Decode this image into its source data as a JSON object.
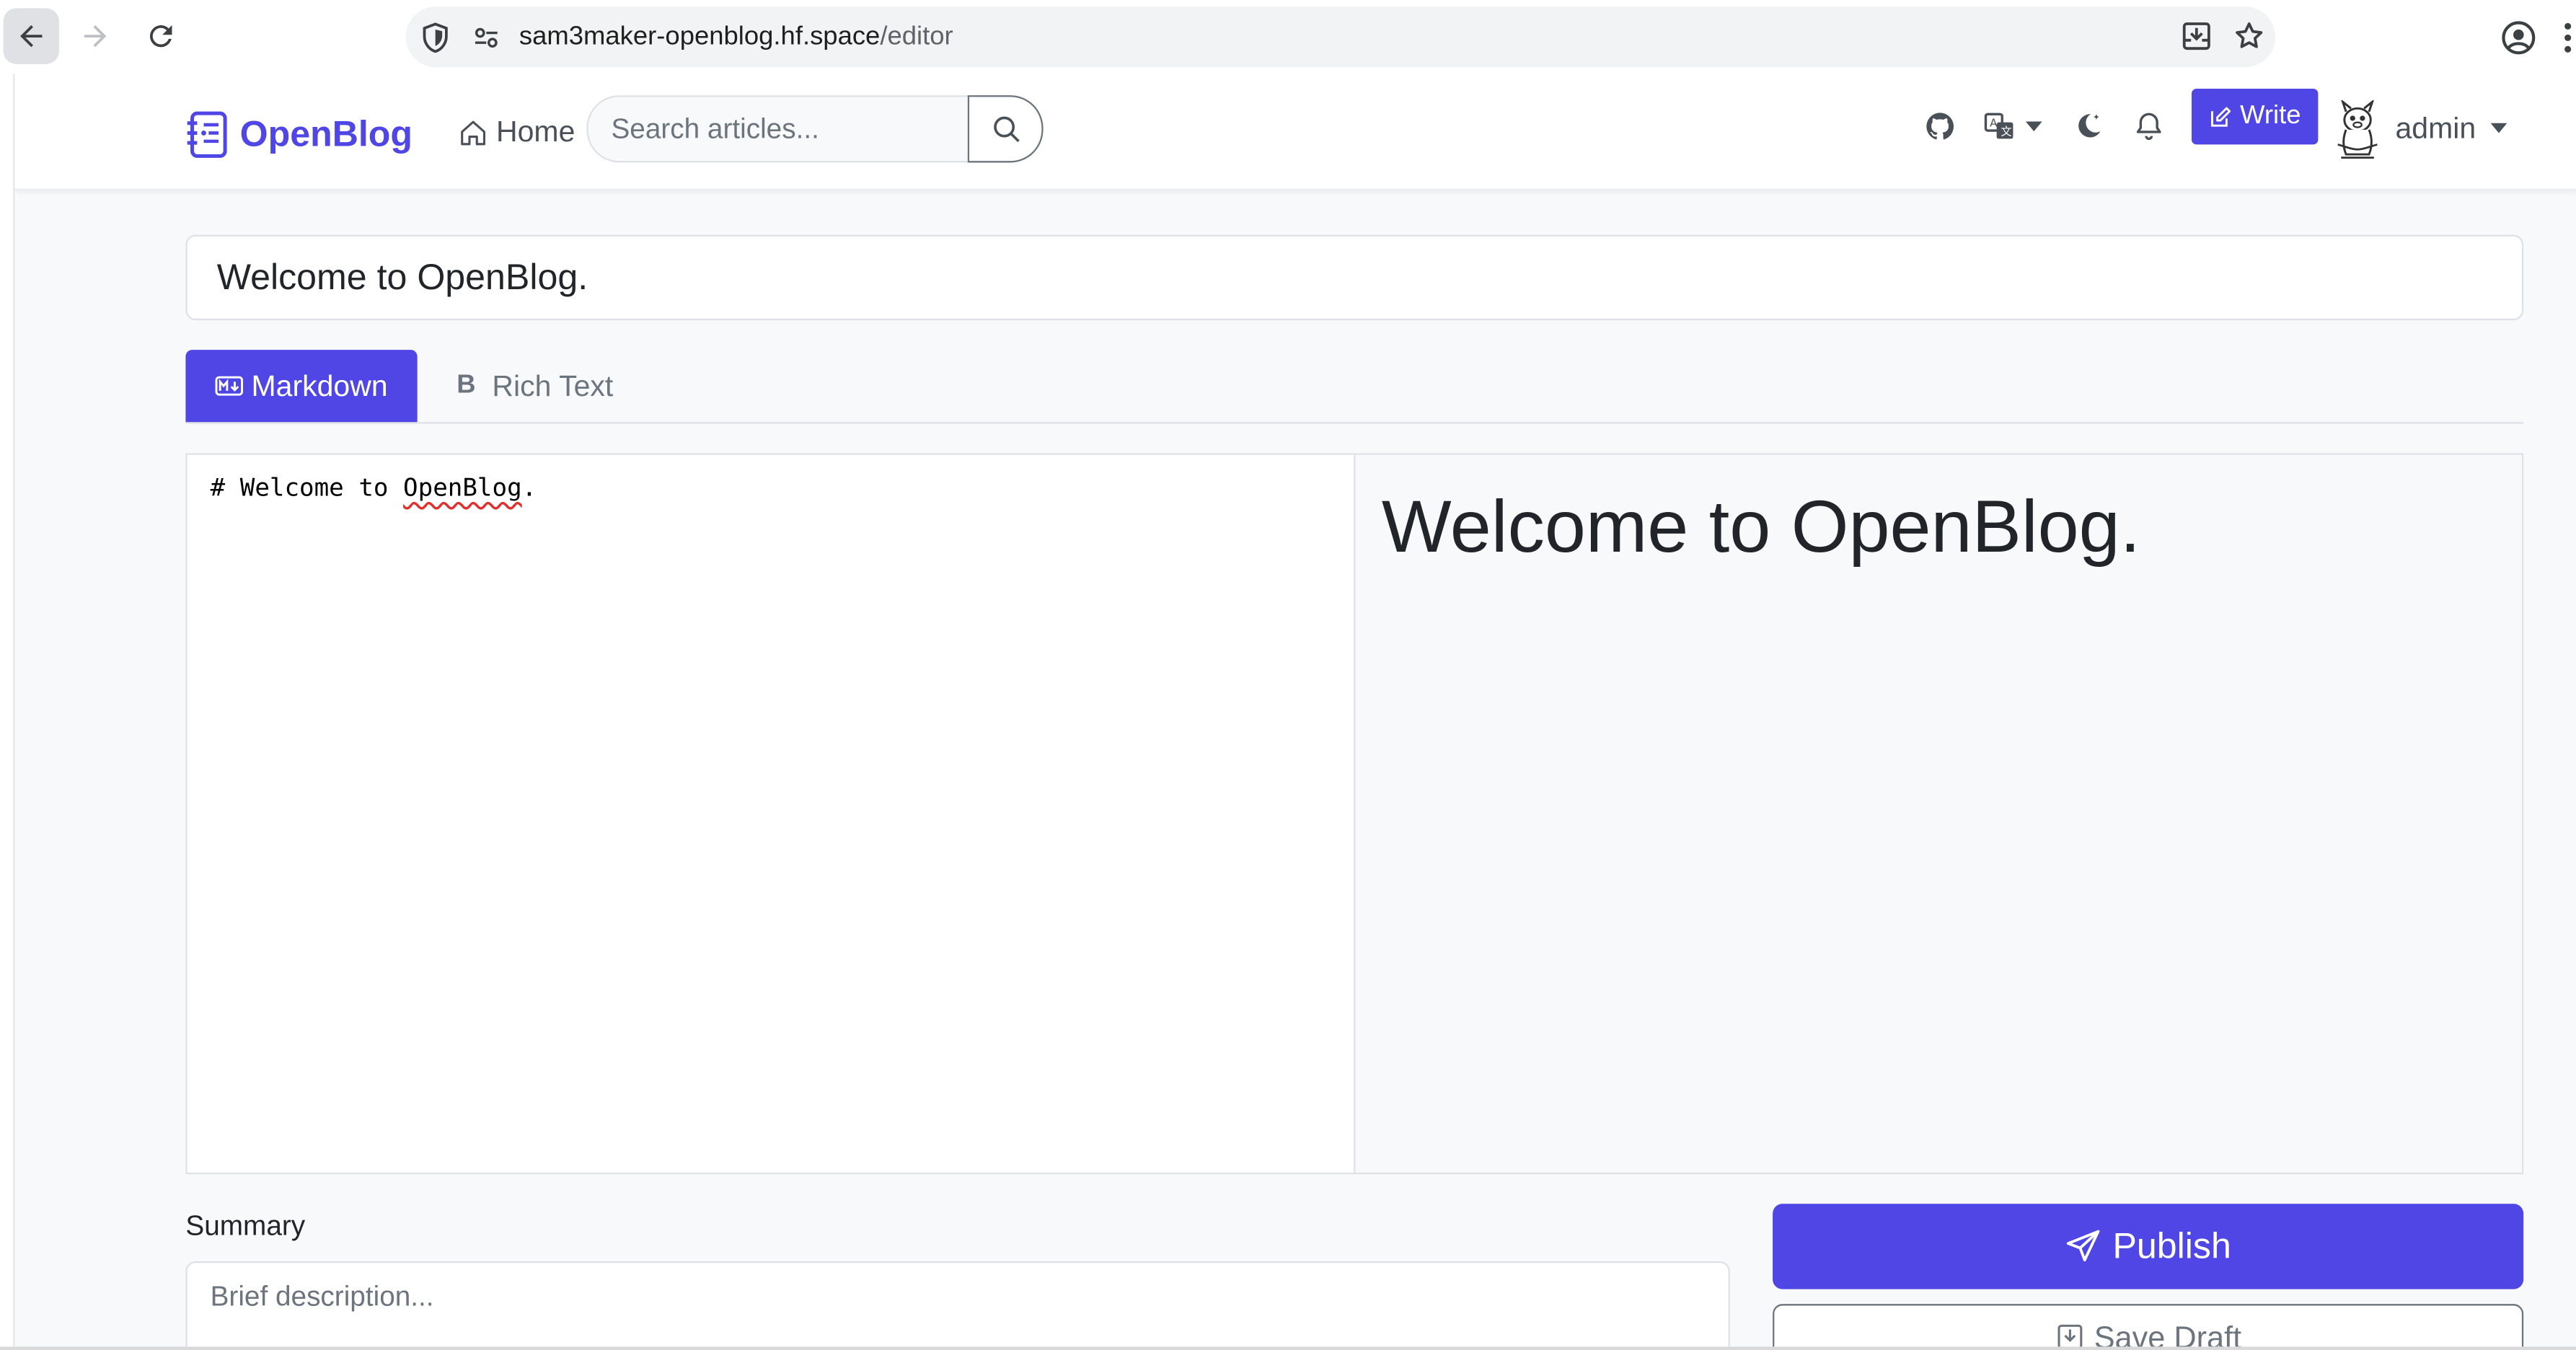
{
  "browser": {
    "url_host": "sam3maker-openblog.hf.space",
    "url_path": "/editor"
  },
  "header": {
    "brand": "OpenBlog",
    "home_label": "Home",
    "search_placeholder": "Search articles...",
    "write_label": "Write",
    "username": "admin"
  },
  "editor": {
    "title_value": "Welcome to OpenBlog.",
    "tabs": [
      {
        "label": "Markdown",
        "active": true
      },
      {
        "label": "Rich Text",
        "active": false
      }
    ],
    "rich_text_prefix": "B",
    "source_prefix": "# Welcome to ",
    "source_misspelled": "OpenBlog",
    "source_suffix": ".",
    "preview_heading": "Welcome to OpenBlog."
  },
  "summary": {
    "label": "Summary",
    "placeholder": "Brief description..."
  },
  "actions": {
    "publish_label": "Publish",
    "save_draft_label": "Save Draft"
  },
  "colors": {
    "accent": "#4f46e5",
    "page_bg": "#f8f9fa"
  }
}
